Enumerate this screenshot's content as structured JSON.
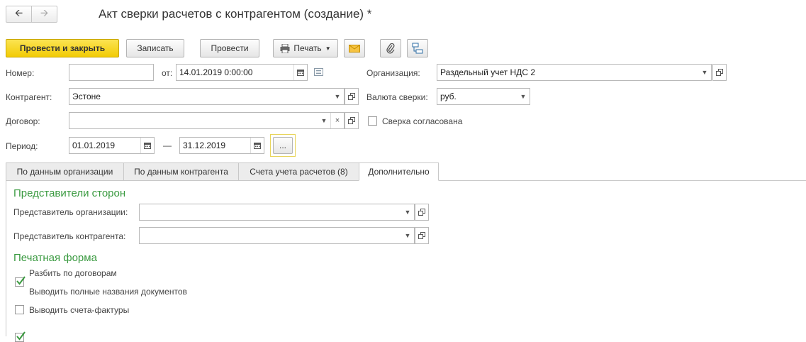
{
  "window": {
    "title": "Акт сверки расчетов с контрагентом (создание) *"
  },
  "toolbar": {
    "post_close": "Провести и закрыть",
    "save": "Записать",
    "post": "Провести",
    "print": "Печать"
  },
  "form": {
    "number": {
      "label": "Номер:",
      "value": ""
    },
    "date": {
      "label": "от:",
      "value": "14.01.2019  0:00:00"
    },
    "organization": {
      "label": "Организация:",
      "value": "Раздельный учет НДС 2"
    },
    "counterparty": {
      "label": "Контрагент:",
      "value": "Эстоне"
    },
    "currency": {
      "label": "Валюта сверки:",
      "value": "руб."
    },
    "contract": {
      "label": "Договор:",
      "value": ""
    },
    "agreed": {
      "label": "Сверка согласована",
      "checked": false
    },
    "period": {
      "label": "Период:",
      "from": "01.01.2019",
      "separator": "—",
      "to": "31.12.2019",
      "select_label": "..."
    }
  },
  "tabs": [
    {
      "label": "По данным организации",
      "active": false
    },
    {
      "label": "По данным контрагента",
      "active": false
    },
    {
      "label": "Счета учета расчетов (8)",
      "active": false
    },
    {
      "label": "Дополнительно",
      "active": true
    }
  ],
  "extra": {
    "representatives_header": "Представители сторон",
    "org_rep": {
      "label": "Представитель организации:",
      "value": ""
    },
    "cp_rep": {
      "label": "Представитель контрагента:",
      "value": ""
    },
    "print_form_header": "Печатная форма",
    "options": [
      {
        "label": "Разбить по договорам",
        "checked": true
      },
      {
        "label": "Выводить полные названия документов",
        "checked": false
      },
      {
        "label": "Выводить счета-фактуры",
        "checked": true
      }
    ]
  },
  "colors": {
    "primary_button": "#f2cb05",
    "section_header": "#3a9a40",
    "check_mark": "#3a9a40"
  }
}
